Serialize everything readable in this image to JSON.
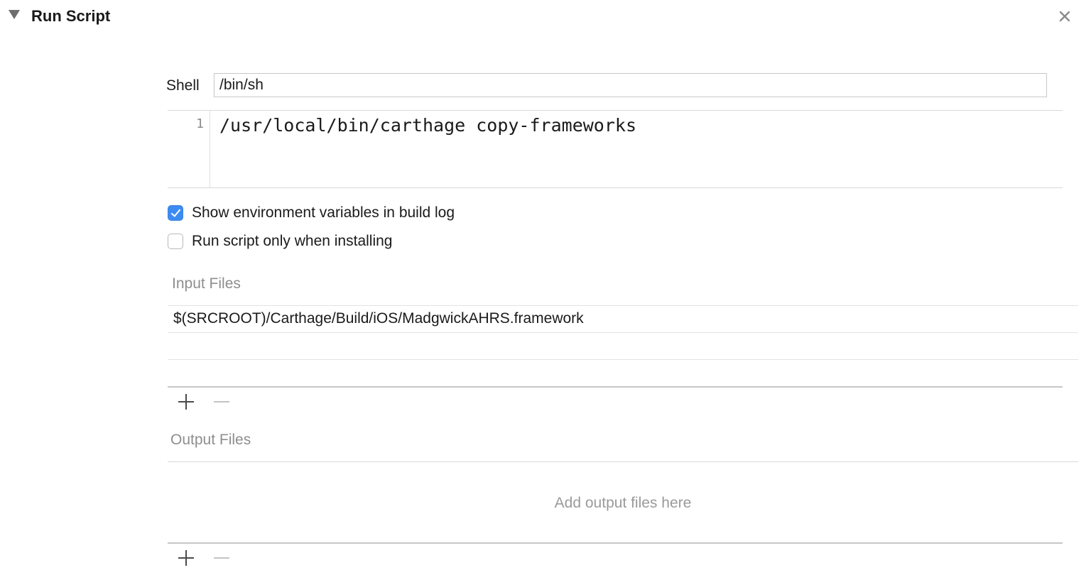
{
  "section": {
    "title": "Run Script",
    "disclosure_icon": "triangle-down-icon",
    "close_icon": "close-icon"
  },
  "shell": {
    "label": "Shell",
    "value": "/bin/sh"
  },
  "script": {
    "line_numbers": [
      "1"
    ],
    "lines": [
      "/usr/local/bin/carthage copy-frameworks"
    ]
  },
  "options": {
    "show_env_vars": {
      "label": "Show environment variables in build log",
      "checked": true
    },
    "run_only_installing": {
      "label": "Run script only when installing",
      "checked": false
    }
  },
  "input_files": {
    "header": "Input Files",
    "rows": [
      "$(SRCROOT)/Carthage/Build/iOS/MadgwickAHRS.framework",
      "",
      ""
    ],
    "add_icon": "plus-icon",
    "remove_icon": "minus-icon"
  },
  "output_files": {
    "header": "Output Files",
    "placeholder": "Add output files here",
    "add_icon": "plus-icon",
    "remove_icon": "minus-icon"
  },
  "colors": {
    "checkbox_accent": "#3d8bf1",
    "secondary_text": "#8e8e8e"
  }
}
